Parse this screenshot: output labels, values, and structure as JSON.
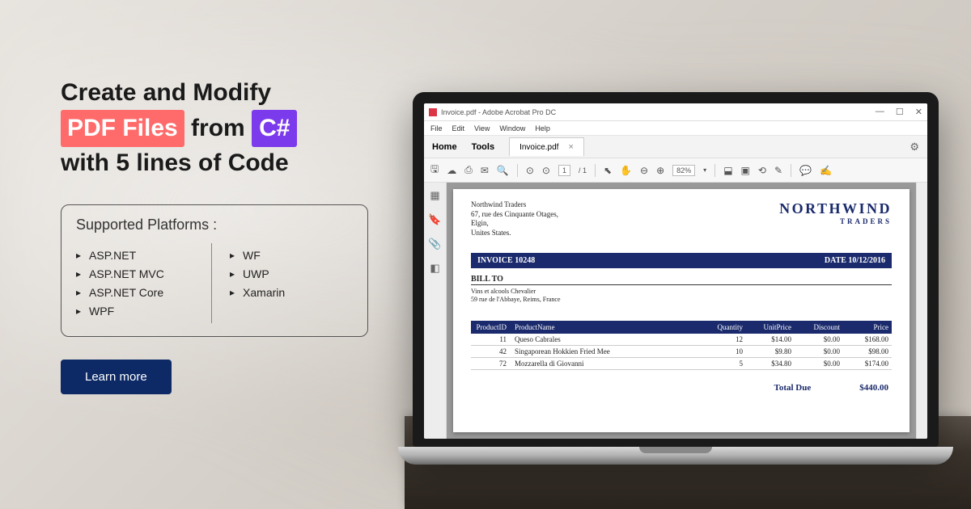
{
  "headline": {
    "line1_a": "Create and Modify",
    "pdf": "PDF Files",
    "from": "from",
    "cs": "C#",
    "line3": "with 5 lines of Code"
  },
  "platforms": {
    "title": "Supported Platforms :",
    "left": [
      "ASP.NET",
      "ASP.NET MVC",
      "ASP.NET Core",
      "WPF"
    ],
    "right": [
      "WF",
      "UWP",
      "Xamarin"
    ]
  },
  "cta": "Learn more",
  "window": {
    "title": "Invoice.pdf - Adobe Acrobat Pro DC",
    "controls": {
      "min": "—",
      "max": "☐",
      "close": "✕"
    },
    "menu": [
      "File",
      "Edit",
      "View",
      "Window",
      "Help"
    ],
    "tabs": {
      "home": "Home",
      "tools": "Tools",
      "doc": "Invoice.pdf"
    },
    "toolbar": {
      "page_current": "1",
      "page_total": "/ 1",
      "zoom": "82%"
    }
  },
  "doc": {
    "address": {
      "l1": "Northwind Traders",
      "l2": "67, rue des Cinquante Otages,",
      "l3": "Elgin,",
      "l4": "Unites States."
    },
    "logo": {
      "main": "NORTHWIND",
      "sub": "TRADERS"
    },
    "invoice_no": "INVOICE 10248",
    "invoice_date": "DATE 10/12/2016",
    "billto_label": "BILL TO",
    "billto": {
      "l1": "Vins et alcools Chevalier",
      "l2": "59 rue de l'Abbaye, Reims, France"
    },
    "headers": {
      "id": "ProductID",
      "name": "ProductName",
      "qty": "Quantity",
      "price": "UnitPrice",
      "disc": "Discount",
      "total": "Price"
    },
    "rows": [
      {
        "id": "11",
        "name": "Queso Cabrales",
        "qty": "12",
        "price": "$14.00",
        "disc": "$0.00",
        "total": "$168.00"
      },
      {
        "id": "42",
        "name": "Singaporean Hokkien Fried Mee",
        "qty": "10",
        "price": "$9.80",
        "disc": "$0.00",
        "total": "$98.00"
      },
      {
        "id": "72",
        "name": "Mozzarella di Giovanni",
        "qty": "5",
        "price": "$34.80",
        "disc": "$0.00",
        "total": "$174.00"
      }
    ],
    "total_label": "Total Due",
    "total_value": "$440.00"
  }
}
